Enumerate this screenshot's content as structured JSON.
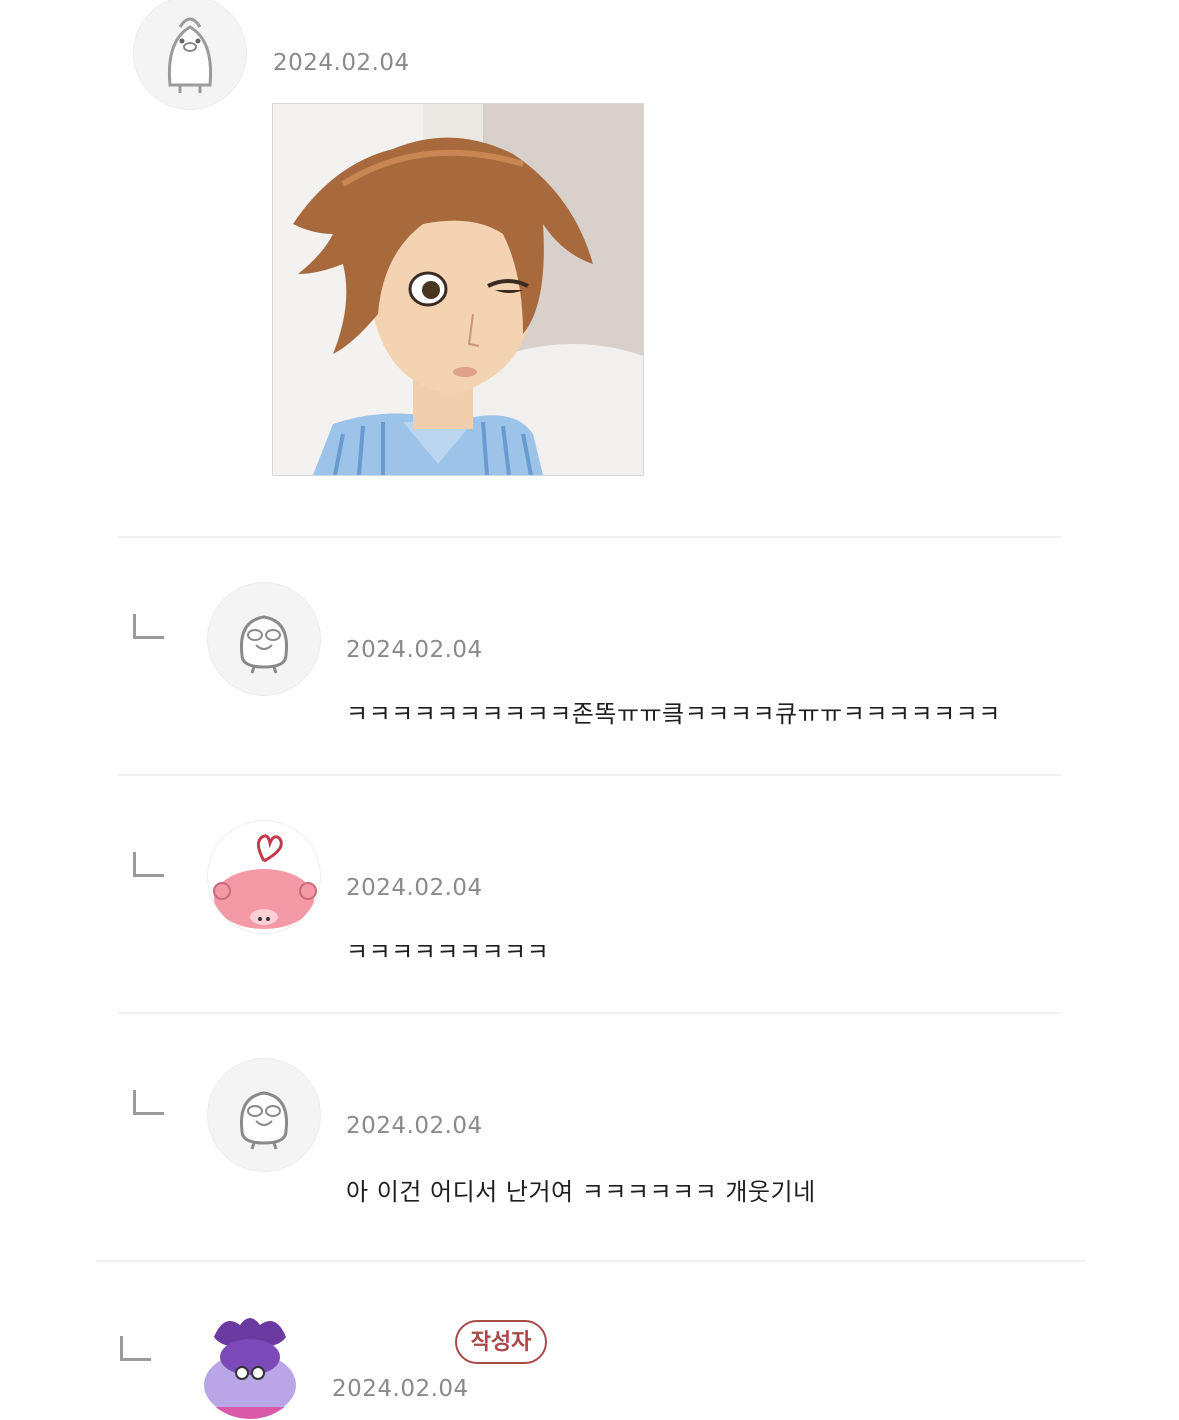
{
  "comments": [
    {
      "date": "2024.02.04",
      "avatar_icon": "penguin-avatar-icon",
      "attachment": "cartoon-character-image"
    },
    {
      "date": "2024.02.04",
      "avatar_icon": "duck-avatar-icon",
      "text": "ㅋㅋㅋㅋㅋㅋㅋㅋㅋㅋ존똑ㅠㅠ킄ㅋㅋㅋㅋ큐ㅠㅠㅋㅋㅋㅋㅋㅋㅋ"
    },
    {
      "date": "2024.02.04",
      "avatar_icon": "pink-bear-avatar-icon",
      "text": "ㅋㅋㅋㅋㅋㅋㅋㅋㅋ"
    },
    {
      "date": "2024.02.04",
      "avatar_icon": "duck-avatar-icon",
      "text": "아 이건 어디서 난거여 ㅋㅋㅋㅋㅋㅋ 개웃기네"
    },
    {
      "date": "2024.02.04",
      "avatar_icon": "purple-character-avatar-icon",
      "badge": "작성자"
    }
  ],
  "colors": {
    "badge": "#a84a4a",
    "date": "#8a8a8a",
    "divider": "#f0f0f0"
  }
}
